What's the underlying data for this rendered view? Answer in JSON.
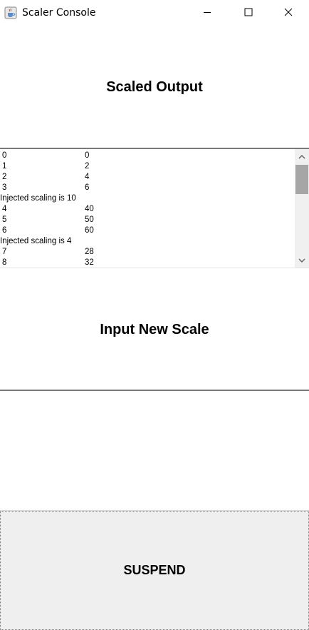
{
  "window": {
    "title": "Scaler Console",
    "icon": "java-cup-icon",
    "controls": [
      "minimize-icon",
      "maximize-icon",
      "close-icon"
    ]
  },
  "output_section": {
    "heading": "Scaled Output",
    "lines": [
      {
        "a": "0",
        "b": "0"
      },
      {
        "a": "1",
        "b": "2"
      },
      {
        "a": "2",
        "b": "4"
      },
      {
        "a": "3",
        "b": "6"
      },
      {
        "a": "Injected scaling is 10",
        "b": ""
      },
      {
        "a": "4",
        "b": "40"
      },
      {
        "a": "5",
        "b": "50"
      },
      {
        "a": "6",
        "b": "60"
      },
      {
        "a": "Injected scaling is 4",
        "b": ""
      },
      {
        "a": "7",
        "b": "28"
      },
      {
        "a": "8",
        "b": "32"
      }
    ]
  },
  "input_section": {
    "heading": "Input New Scale",
    "value": "",
    "placeholder": ""
  },
  "suspend_button": {
    "label": "SUSPEND"
  }
}
